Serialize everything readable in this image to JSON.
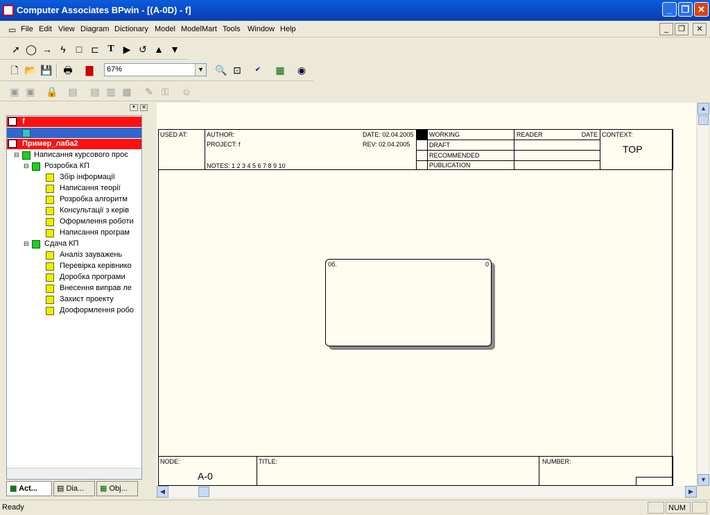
{
  "window": {
    "title": "Computer Associates BPwin - [(A-0D)  - f]"
  },
  "menu": [
    "File",
    "Edit",
    "View",
    "Diagram",
    "Dictionary",
    "Model",
    "ModelMart",
    "Tools",
    "Window",
    "Help"
  ],
  "zoom": {
    "value": "67%"
  },
  "tree": {
    "model1": "f",
    "model2": "Пример_лаба2",
    "root": "Написання курсового проє",
    "group1": "Розробка КП",
    "group1_items": [
      "Збір інформації",
      "Написання теорії",
      "Розробка алгоритм",
      "Консультації з керів",
      "Оформлення роботи",
      "Написання програм"
    ],
    "group2": "Сдача КП",
    "group2_items": [
      "Аналіз зауважень",
      "Перевірка керівнико",
      "Доробка програми",
      "Внесення виправ ле",
      "Захист проекту",
      "Дооформлення робо"
    ]
  },
  "tabs": [
    "Act...",
    "Dia...",
    "Obj..."
  ],
  "frame": {
    "used_at": "USED AT:",
    "author": "AUTHOR:",
    "project": "PROJECT:  f",
    "date": "DATE: 02.04.2005",
    "rev": "REV:  02.04.2005",
    "notes": "NOTES:  1  2  3  4  5  6  7  8  9  10",
    "working": "WORKING",
    "draft": "DRAFT",
    "recommended": "RECOMMENDED",
    "publication": "PUBLICATION",
    "reader": "READER",
    "date_col": "DATE",
    "context": "CONTEXT:",
    "context_value": "TOP",
    "node": "NODE:",
    "node_value": "A-0",
    "title_label": "TITLE:",
    "number": "NUMBER:"
  },
  "activity_box": {
    "label_left": "0б.",
    "label_right": "0"
  },
  "status": {
    "text": "Ready",
    "num": "NUM"
  }
}
